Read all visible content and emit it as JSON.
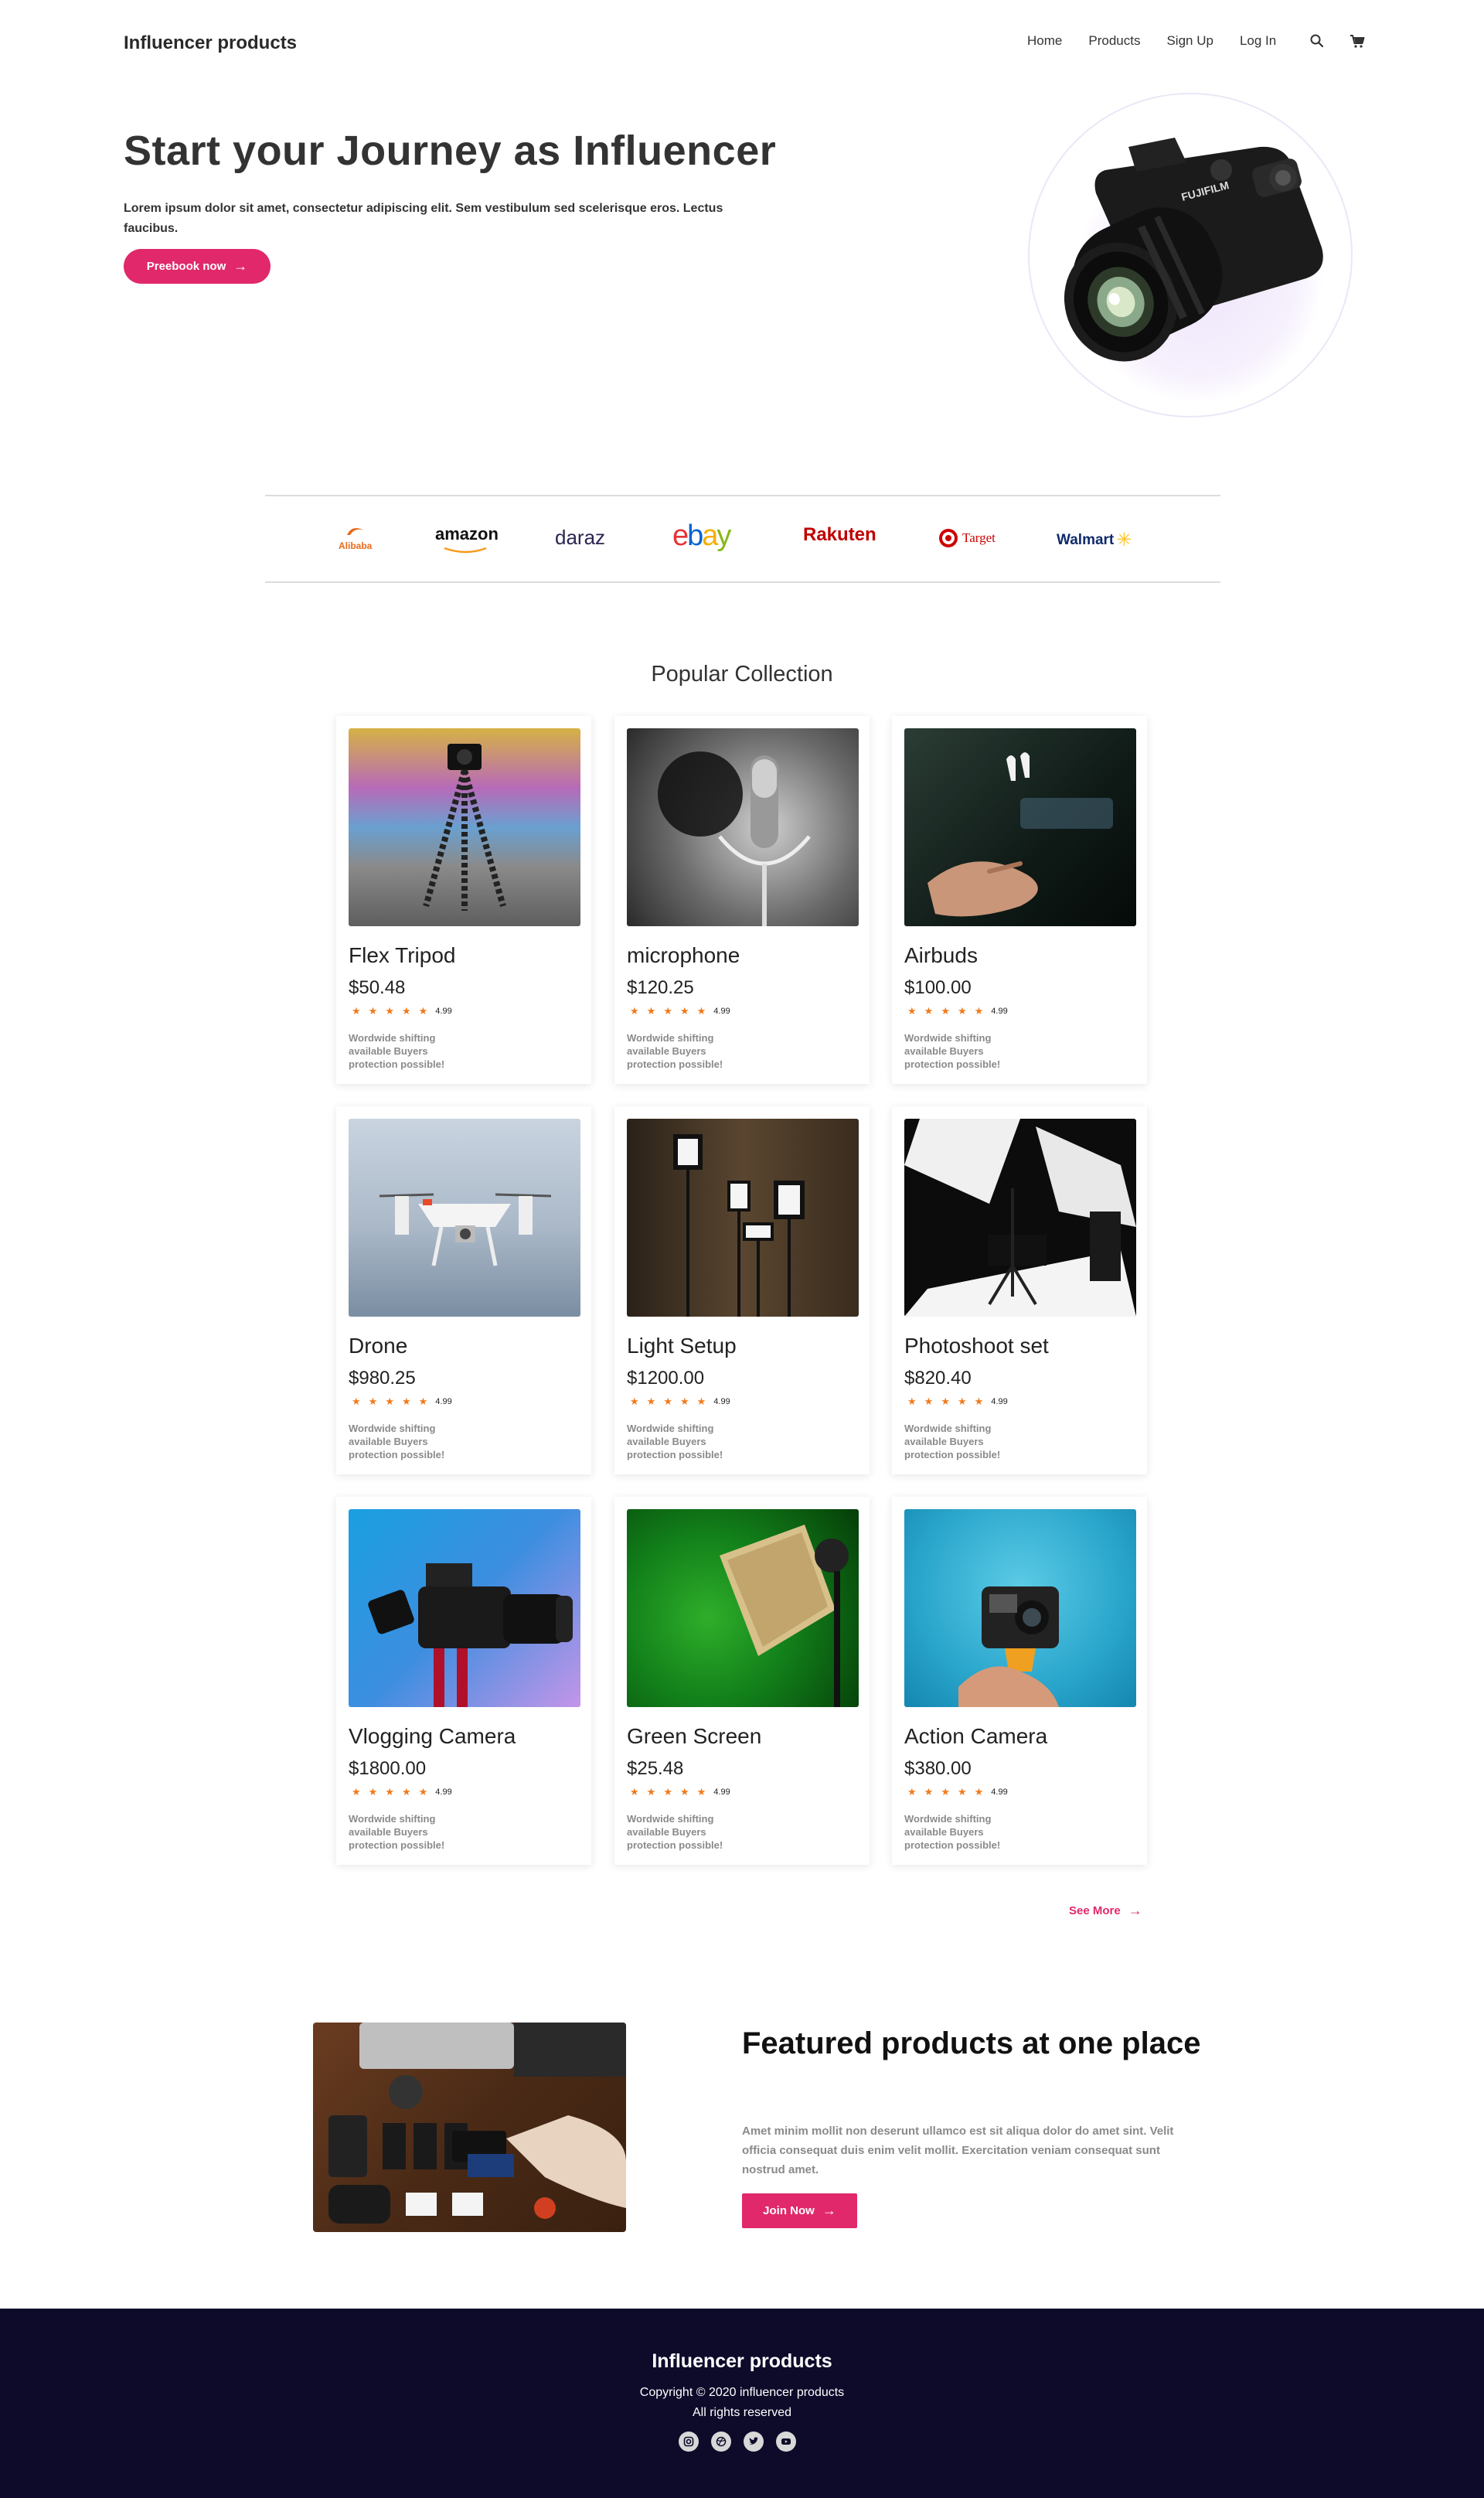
{
  "header": {
    "brand": "Influencer products",
    "nav": [
      "Home",
      "Products",
      "Sign Up",
      "Log In"
    ],
    "icons": [
      "search-icon",
      "cart-icon"
    ]
  },
  "hero": {
    "title": "Start your Journey as Influencer",
    "subtitle": "Lorem ipsum dolor sit amet, consectetur adipiscing elit. Sem vestibulum sed scelerisque eros. Lectus faucibus.",
    "button": "Preebook now"
  },
  "brands": [
    "Alibaba",
    "amazon",
    "daraz",
    "ebay",
    "Rakuten",
    "Target",
    "Walmart"
  ],
  "collection": {
    "title": "Popular Collection",
    "products": [
      {
        "name": "Flex Tripod",
        "price": "$50.48",
        "rating": "4.99",
        "desc": "Wordwide shifting available Buyers protection possible!"
      },
      {
        "name": "microphone",
        "price": "$120.25",
        "rating": "4.99",
        "desc": "Wordwide shifting available Buyers protection possible!"
      },
      {
        "name": "Airbuds",
        "price": "$100.00",
        "rating": "4.99",
        "desc": "Wordwide shifting available Buyers protection possible!"
      },
      {
        "name": "Drone",
        "price": "$980.25",
        "rating": "4.99",
        "desc": "Wordwide shifting available Buyers protection possible!"
      },
      {
        "name": "Light Setup",
        "price": "$1200.00",
        "rating": "4.99",
        "desc": "Wordwide shifting available Buyers protection possible!"
      },
      {
        "name": "Photoshoot set",
        "price": "$820.40",
        "rating": "4.99",
        "desc": "Wordwide shifting available Buyers protection possible!"
      },
      {
        "name": "Vlogging Camera",
        "price": "$1800.00",
        "rating": "4.99",
        "desc": "Wordwide shifting available Buyers protection possible!"
      },
      {
        "name": "Green Screen",
        "price": "$25.48",
        "rating": "4.99",
        "desc": "Wordwide shifting available Buyers protection possible!"
      },
      {
        "name": "Action Camera",
        "price": "$380.00",
        "rating": "4.99",
        "desc": "Wordwide shifting available Buyers protection possible!"
      }
    ],
    "see_more": "See More"
  },
  "featured": {
    "title": "Featured products at one place",
    "desc": "Amet minim mollit non deserunt ullamco est sit aliqua dolor do amet sint. Velit officia consequat duis enim velit mollit. Exercitation veniam consequat sunt nostrud amet.",
    "button": "Join Now"
  },
  "footer": {
    "title": "Influencer products",
    "copyright": "Copyright © 2020 influencer products",
    "rights": "All rights reserved",
    "social": [
      "instagram-icon",
      "dribbble-icon",
      "twitter-icon",
      "youtube-icon"
    ]
  },
  "colors": {
    "accent": "#e0286a",
    "footer_bg": "#0d0a2a",
    "star": "#f07a1c"
  }
}
